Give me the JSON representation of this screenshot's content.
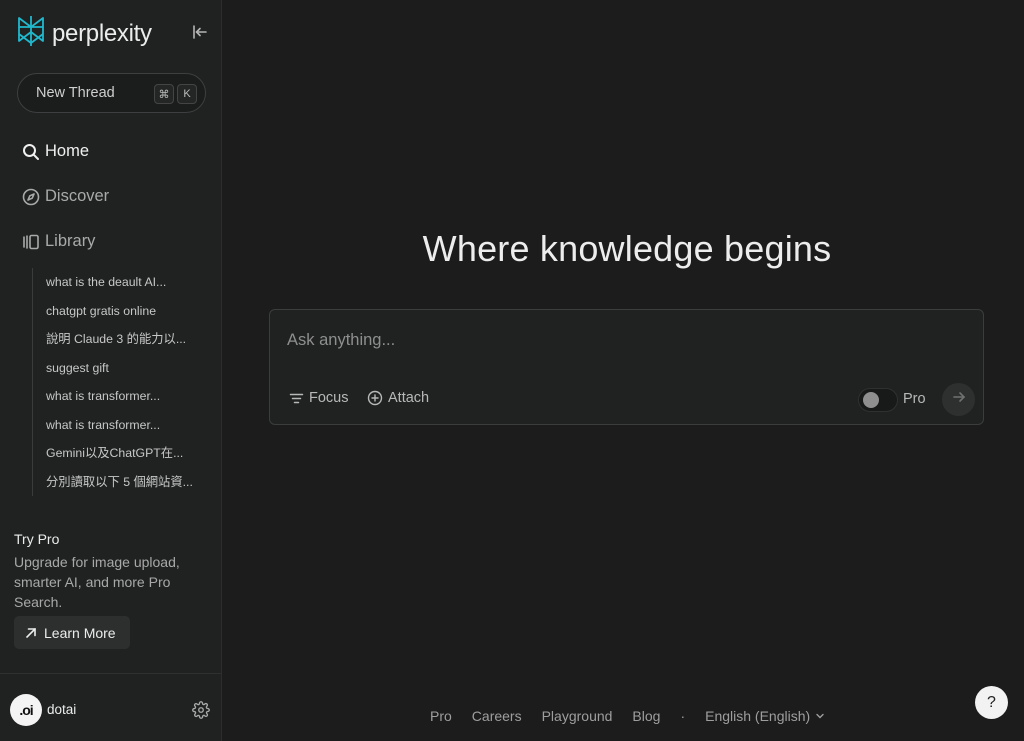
{
  "app": {
    "name": "perplexity",
    "accent_color": "#20b8cd"
  },
  "sidebar": {
    "logo_icon": "perplexity-logo-icon",
    "collapse_icon": "collapse-sidebar-icon",
    "new_thread": {
      "label": "New Thread",
      "shortcut_keys": [
        "⌘",
        "K"
      ]
    },
    "nav": [
      {
        "label": "Home",
        "icon": "search-icon",
        "active": true
      },
      {
        "label": "Discover",
        "icon": "compass-icon",
        "active": false
      },
      {
        "label": "Library",
        "icon": "library-icon",
        "active": false
      }
    ],
    "history": [
      "what is the deault AI...",
      "chatgpt gratis online",
      "說明 Claude 3 的能力以...",
      "suggest gift",
      "what is transformer...",
      "what is transformer...",
      "Gemini以及ChatGPT在...",
      "分別讀取以下 5 個網站資..."
    ],
    "try_pro": {
      "title": "Try Pro",
      "description": "Upgrade for image upload, smarter AI, and more Pro Search.",
      "button_label": "Learn More",
      "button_icon": "arrow-up-right-icon"
    },
    "user": {
      "avatar_text": ".oi",
      "name": "dotai",
      "settings_icon": "gear-icon"
    }
  },
  "main": {
    "headline": "Where knowledge begins",
    "ask_box": {
      "placeholder": "Ask anything...",
      "value": "",
      "focus_label": "Focus",
      "focus_icon": "filter-icon",
      "attach_label": "Attach",
      "attach_icon": "plus-circle-icon",
      "pro_label": "Pro",
      "pro_enabled": false,
      "submit_icon": "arrow-right-icon"
    }
  },
  "footer": {
    "links": [
      "Pro",
      "Careers",
      "Playground",
      "Blog"
    ],
    "separator": "·",
    "language": "English (English)",
    "language_icon": "chevron-down-icon",
    "help_label": "?"
  }
}
